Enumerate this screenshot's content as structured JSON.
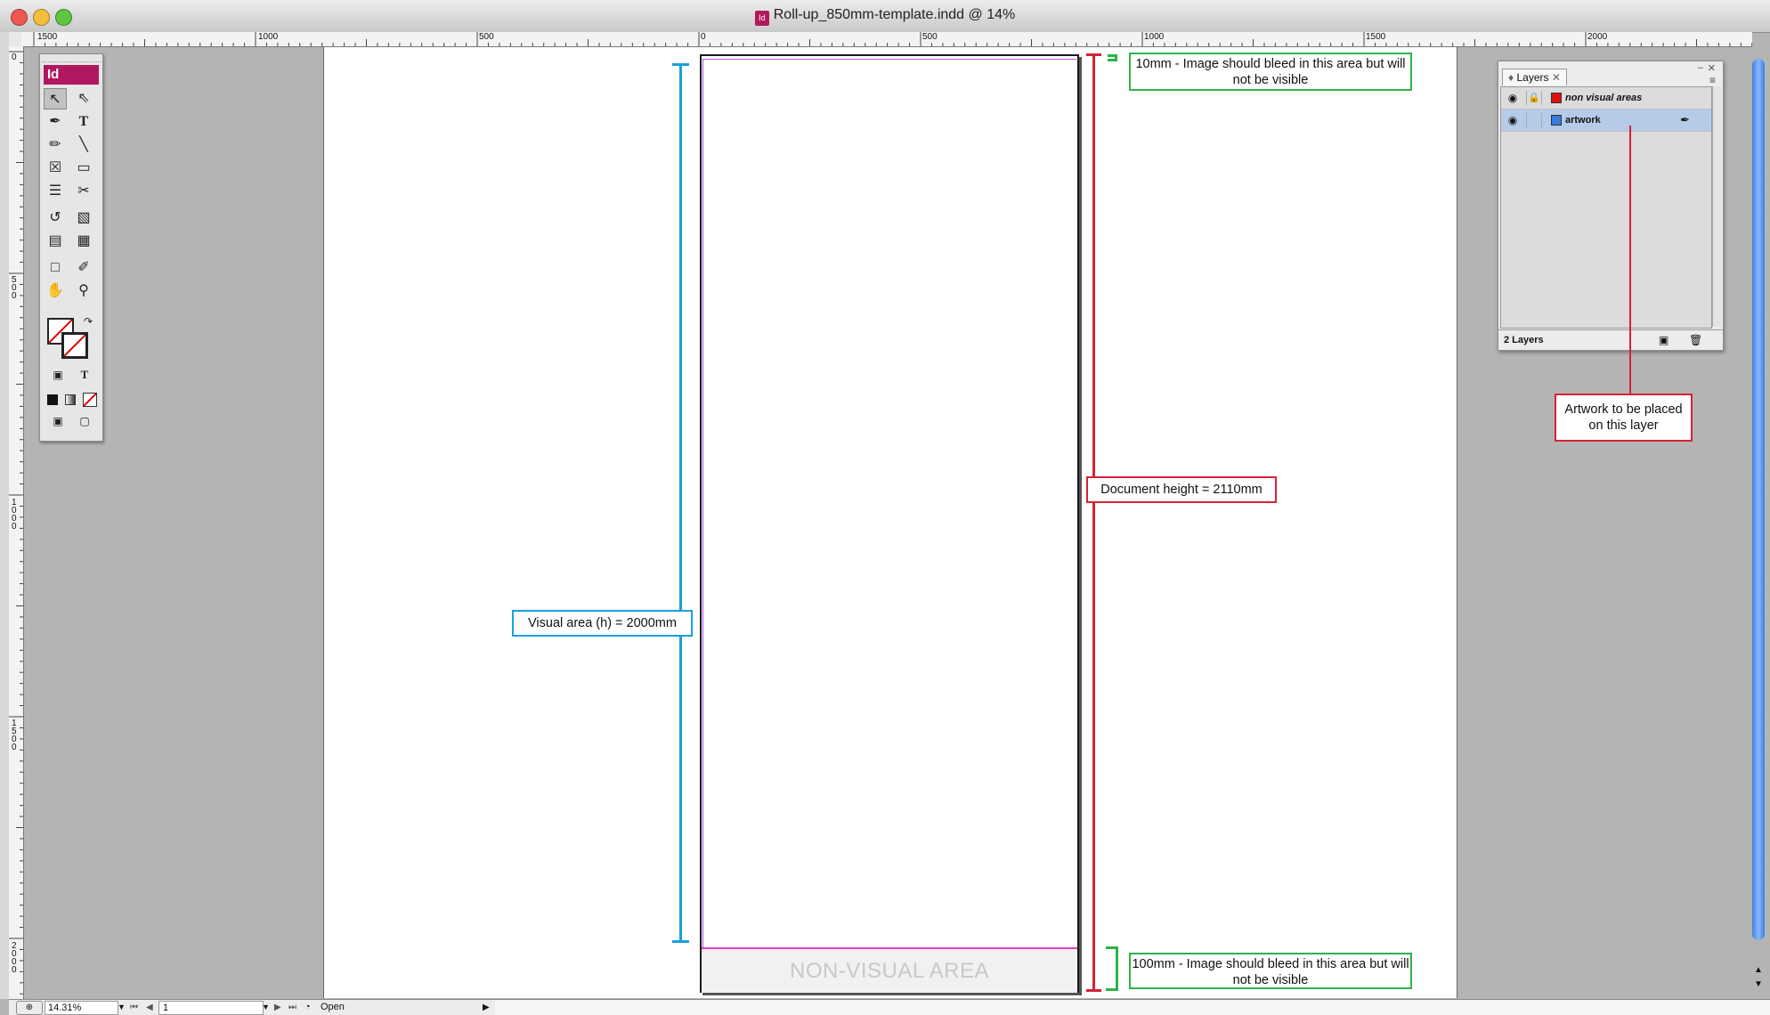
{
  "window": {
    "title": "Roll-up_850mm-template.indd @ 14%",
    "app_badge": "Id"
  },
  "rulers": {
    "horizontal_ticks": [
      "1500",
      "1000",
      "500",
      "0",
      "500",
      "1000",
      "1500",
      "2000"
    ],
    "vertical_ticks": [
      "0",
      "500",
      "1000",
      "1500",
      "2000"
    ]
  },
  "page": {
    "nonvisual_label": "NON-VISUAL AREA"
  },
  "annotations": {
    "bleed_top": "10mm - Image should bleed in this area but will not be visible",
    "bleed_bottom": "100mm - Image should bleed in this area but will not be visible",
    "document_height": "Document height = 2110mm",
    "visual_area": "Visual area (h) = 2000mm",
    "artwork_layer": "Artwork to be placed on this layer"
  },
  "layers_panel": {
    "tab_label": "Layers",
    "layers": [
      {
        "name": "non visual areas",
        "color": "#e01010",
        "locked": true,
        "selected": false
      },
      {
        "name": "artwork",
        "color": "#3a7de0",
        "locked": false,
        "selected": true
      }
    ],
    "footer_count": "2 Layers"
  },
  "statusbar": {
    "zoom": "14.31%",
    "page_number": "1",
    "status": "Open"
  },
  "colors": {
    "green": "#2cb34a",
    "red": "#d42333",
    "blue": "#1aa0dc",
    "indesign": "#b0195f"
  }
}
